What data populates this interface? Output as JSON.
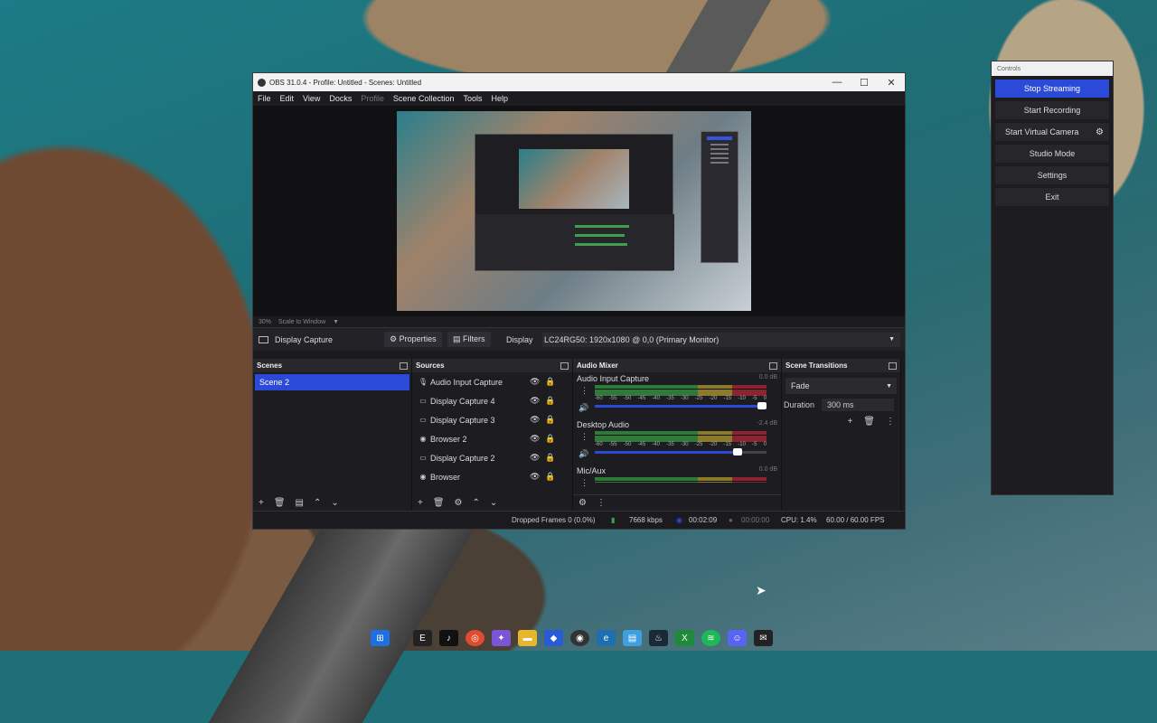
{
  "window": {
    "title": "OBS 31.0.4 - Profile: Untitled - Scenes: Untitled",
    "min": "—",
    "max": "☐",
    "close": "✕"
  },
  "menu": [
    "File",
    "Edit",
    "View",
    "Docks",
    "Profile",
    "Scene Collection",
    "Tools",
    "Help"
  ],
  "zoom": {
    "percent": "30%",
    "mode": "Scale to Window"
  },
  "source_bar": {
    "selected_source": "Display Capture",
    "properties": "Properties",
    "filters": "Filters",
    "display_label": "Display",
    "display_value": "LC24RG50: 1920x1080 @ 0,0 (Primary Monitor)"
  },
  "scenes": {
    "title": "Scenes",
    "items": [
      "Scene 2"
    ]
  },
  "sources": {
    "title": "Sources",
    "items": [
      {
        "name": "Audio Input Capture",
        "icon": "microphone-icon"
      },
      {
        "name": "Display Capture 4",
        "icon": "monitor-icon"
      },
      {
        "name": "Display Capture 3",
        "icon": "monitor-icon"
      },
      {
        "name": "Browser 2",
        "icon": "globe-icon"
      },
      {
        "name": "Display Capture 2",
        "icon": "monitor-icon"
      },
      {
        "name": "Browser",
        "icon": "globe-icon"
      }
    ]
  },
  "mixer": {
    "title": "Audio Mixer",
    "channels": [
      {
        "name": "Audio Input Capture",
        "db": "0.0 dB",
        "volume": 1.0
      },
      {
        "name": "Desktop Audio",
        "db": "-2.4 dB",
        "volume": 0.86
      },
      {
        "name": "Mic/Aux",
        "db": "0.0 dB",
        "volume": 1.0
      }
    ],
    "ticks": [
      "-60",
      "-55",
      "-50",
      "-45",
      "-40",
      "-35",
      "-30",
      "-25",
      "-20",
      "-15",
      "-10",
      "-5",
      "0"
    ]
  },
  "transitions": {
    "title": "Scene Transitions",
    "type": "Fade",
    "duration_label": "Duration",
    "duration_value": "300 ms"
  },
  "status": {
    "dropped": "Dropped Frames 0 (0.0%)",
    "bitrate": "7668 kbps",
    "stream_time": "00:02:09",
    "rec_time": "00:00:00",
    "cpu": "CPU: 1.4%",
    "fps": "60.00 / 60.00 FPS"
  },
  "controls": {
    "title": "Controls",
    "stop_streaming": "Stop Streaming",
    "start_recording": "Start Recording",
    "start_virtual_camera": "Start Virtual Camera",
    "studio_mode": "Studio Mode",
    "settings": "Settings",
    "exit": "Exit"
  },
  "colors": {
    "accent": "#2c4ad8",
    "meter_green": "#2f7a3a",
    "meter_yellow": "#8a7a2a",
    "meter_red": "#8a2433"
  }
}
